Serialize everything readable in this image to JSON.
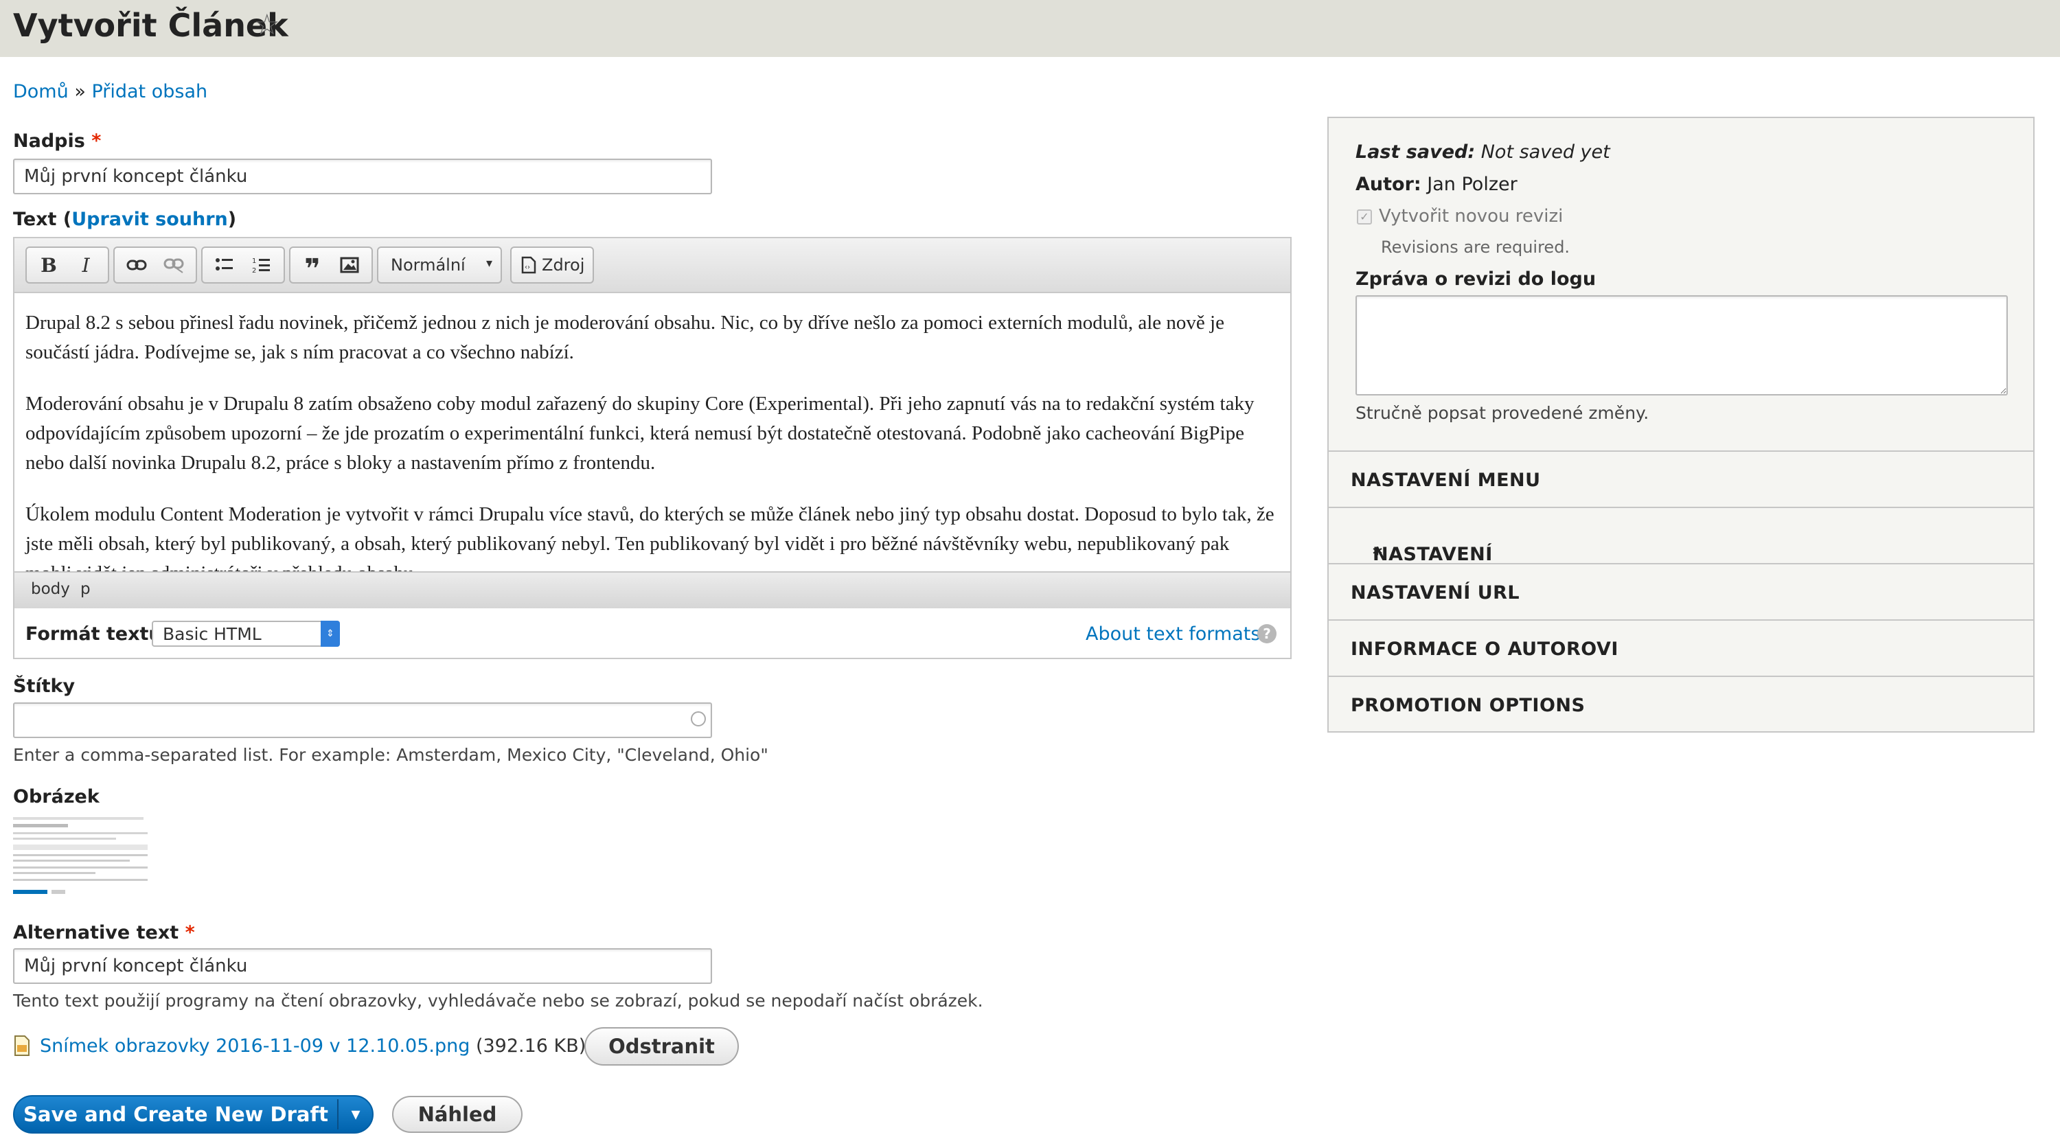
{
  "header": {
    "title": "Vytvořit Článek"
  },
  "breadcrumb": {
    "home": "Domů",
    "separator": "»",
    "current": "Přidat obsah"
  },
  "title_field": {
    "label": "Nadpis",
    "required_mark": "*",
    "value": "Můj první koncept článku"
  },
  "body_field": {
    "label": "Text",
    "summary_open": "(",
    "summary_link": "Upravit souhrn",
    "summary_close": ")",
    "toolbar": {
      "bold": "B",
      "italic": "I",
      "link_icon": "link-icon",
      "unlink_icon": "unlink-icon",
      "bullet_list_icon": "bullet-list-icon",
      "numbered_list_icon": "numbered-list-icon",
      "blockquote": "❞",
      "image_icon": "image-icon",
      "format_select": "Normální",
      "source_button": "Zdroj"
    },
    "paragraphs": [
      "Drupal 8.2 s sebou přinesl řadu novinek, přičemž jednou z nich je moderování obsahu. Nic, co by dříve nešlo za pomoci externích modulů, ale nově je součástí jádra. Podívejme se, jak s ním pracovat a co všechno nabízí.",
      "Moderování obsahu je v Drupalu 8 zatím obsaženo coby modul zařazený do skupiny Core (Experimental). Při jeho zapnutí vás na to redakční systém taky odpovídajícím způsobem upozorní – že jde prozatím o experimentální funkci, která nemusí být dostatečně otestovaná. Podobně jako cacheování BigPipe nebo další novinka Drupalu 8.2, práce s bloky a nastavením přímo z frontendu.",
      "Úkolem modulu Content Moderation je vytvořit v rámci Drupalu více stavů, do kterých se může článek nebo jiný typ obsahu dostat. Doposud to bylo tak, že jste měli obsah, který byl publikovaný, a obsah, který publikovaný nebyl. Ten publikovaný byl vidět i pro běžné návštěvníky webu, nepublikovaný pak mohli vidět jen administrátoři v přehledu obsahu."
    ],
    "path": [
      "body",
      "p"
    ],
    "format_label": "Formát textu",
    "format_value": "Basic HTML",
    "about_formats": "About text formats",
    "help_icon": "?"
  },
  "tags_field": {
    "label": "Štítky",
    "value": "",
    "description": "Enter a comma-separated list. For example: Amsterdam, Mexico City, \"Cleveland, Ohio\""
  },
  "image_field": {
    "label": "Obrázek",
    "alt_label": "Alternative text",
    "alt_required": "*",
    "alt_value": "Můj první koncept článku",
    "alt_description": "Tento text použijí programy na čtení obrazovky, vyhledávače nebo se zobrazí, pokud se nepodaří načíst obrázek.",
    "file_name": "Snímek obrazovky 2016-11-09 v 12.10.05.png",
    "file_size": "(392.16 KB)",
    "remove_button": "Odstranit"
  },
  "actions": {
    "save": "Save and Create New Draft",
    "dropdown": "▾",
    "preview": "Náhled"
  },
  "sidebar": {
    "last_saved_label": "Last saved:",
    "last_saved_value": "Not saved yet",
    "author_label": "Autor:",
    "author_value": "Jan Polzer",
    "revision_checkbox": "Vytvořit novou revizi",
    "revision_checked": true,
    "revision_note": "Revisions are required.",
    "log_label": "Zpráva o revizi do logu",
    "log_value": "",
    "log_description": "Stručně popsat provedené změny.",
    "sections": [
      {
        "label": "NASTAVENÍ MENU",
        "required": ""
      },
      {
        "label": "NASTAVENÍ KOMENTÁŘŮ",
        "required": "*"
      },
      {
        "label": "NASTAVENÍ URL",
        "required": ""
      },
      {
        "label": "INFORMACE O AUTOROVI",
        "required": ""
      },
      {
        "label": "PROMOTION OPTIONS",
        "required": ""
      }
    ]
  },
  "colors": {
    "link": "#0074bd",
    "primary_button": "#0071b8",
    "required": "#e32700",
    "header_bg": "#e0e0d8"
  }
}
